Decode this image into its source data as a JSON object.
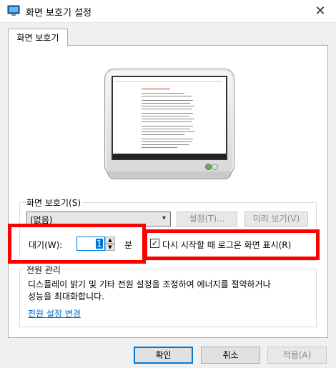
{
  "window": {
    "title": "화면 보호기 설정"
  },
  "tabs": [
    {
      "label": "화면 보호기"
    }
  ],
  "screensaver": {
    "group_label": "화면 보호기(S)",
    "selected": "(없음)",
    "settings_label": "설정(T)...",
    "preview_label": "미리 보기(V)"
  },
  "wait": {
    "label": "대기(W):",
    "value": "1",
    "unit": "분",
    "resume_checkbox_label": "다시 시작할 때 로그온 화면 표시(R)",
    "resume_checked": true
  },
  "power": {
    "group_label": "전원 관리",
    "description_line1": "디스플레이 밝기 및 기타 전원 설정을 조정하여 에너지를 절약하거나",
    "description_line2": "성능을 최대화합니다.",
    "link": "전원 설정 변경"
  },
  "buttons": {
    "ok": "확인",
    "cancel": "취소",
    "apply": "적용(A)"
  },
  "colors": {
    "highlight_box": "#ff0000",
    "accent": "#0078d7",
    "link": "#0066cc"
  }
}
